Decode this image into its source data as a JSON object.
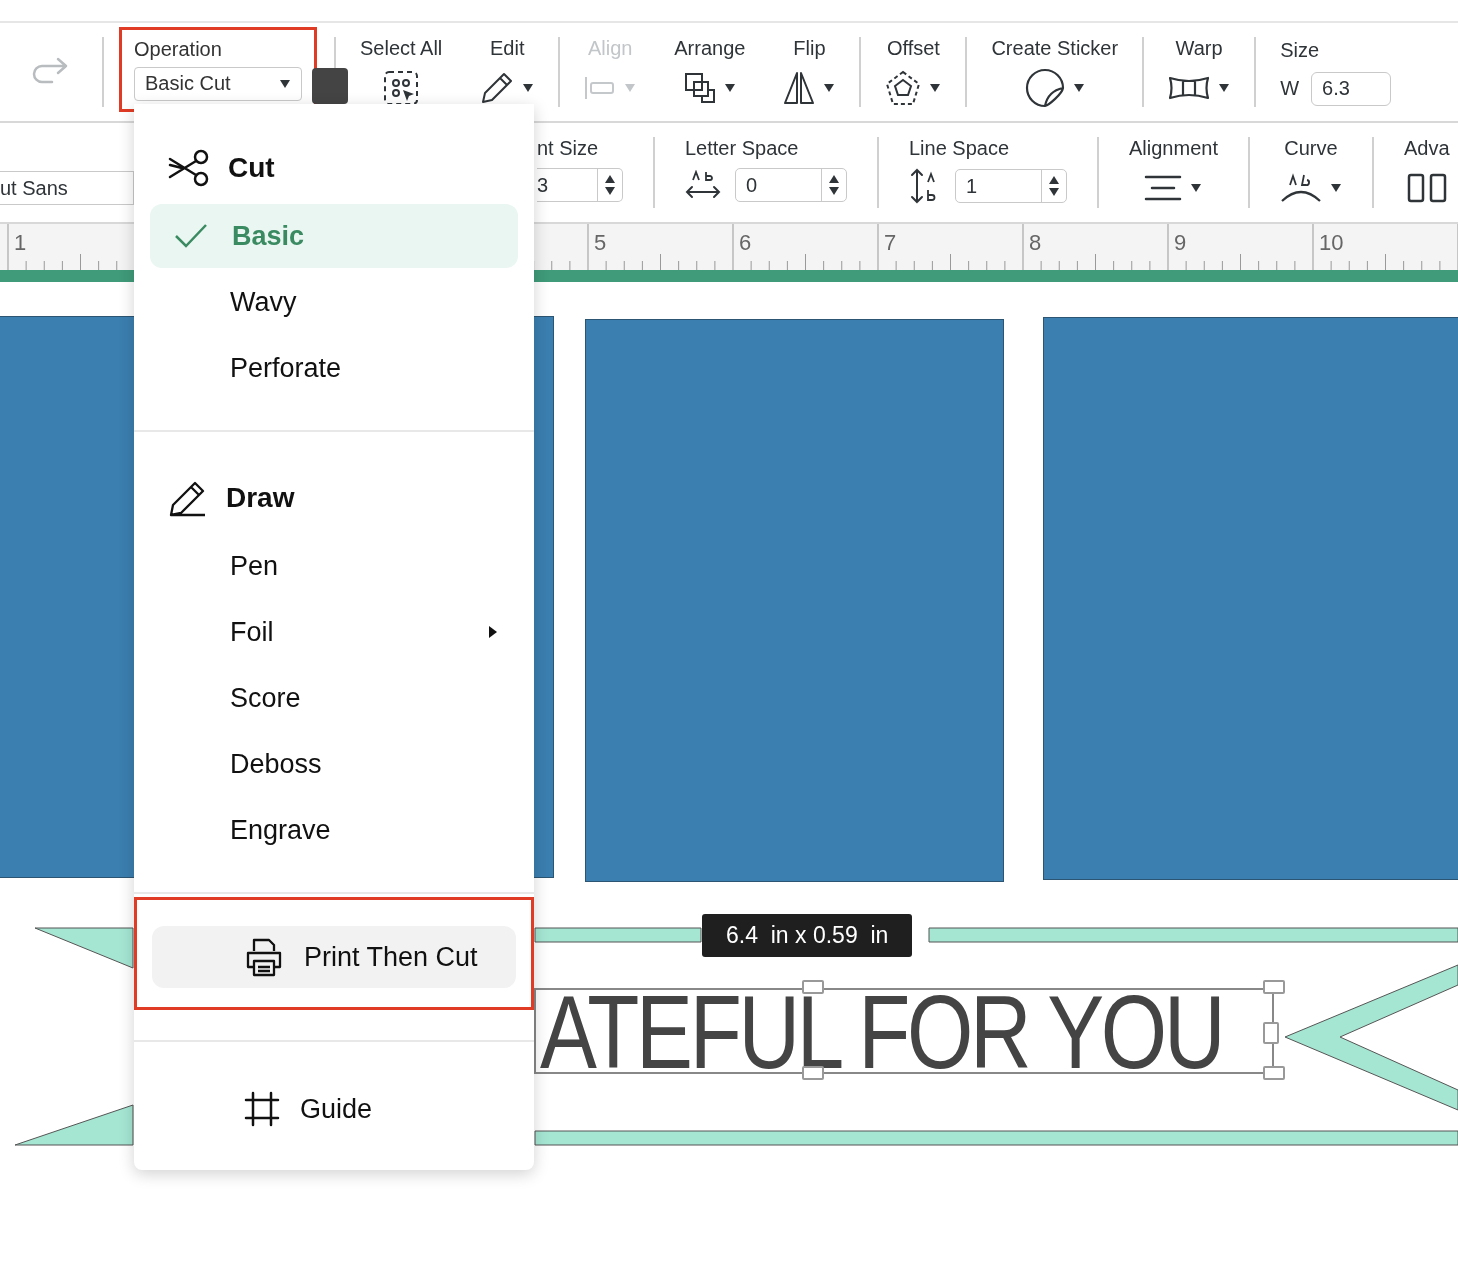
{
  "toolbar": {
    "groups": [
      {
        "tools": [
          {
            "kind": "icon",
            "disabled": true
          }
        ]
      },
      {
        "tools": [
          {
            "kind": "select",
            "label": "Operation",
            "value": "Basic Cut",
            "highlighted": true
          }
        ]
      },
      {
        "tools": [
          {
            "kind": "tool",
            "label": "Select All",
            "dropdown": false,
            "disabled": false
          },
          {
            "kind": "tool",
            "label": "Edit",
            "dropdown": true,
            "disabled": false
          }
        ]
      },
      {
        "tools": [
          {
            "kind": "tool",
            "label": "Align",
            "dropdown": true,
            "disabled": true
          },
          {
            "kind": "tool",
            "label": "Arrange",
            "dropdown": true,
            "disabled": false
          },
          {
            "kind": "tool",
            "label": "Flip",
            "dropdown": true,
            "disabled": false
          }
        ]
      },
      {
        "tools": [
          {
            "kind": "tool",
            "label": "Offset",
            "dropdown": true,
            "disabled": false
          }
        ]
      },
      {
        "tools": [
          {
            "kind": "tool",
            "label": "Create Sticker",
            "dropdown": true,
            "disabled": false
          }
        ]
      },
      {
        "tools": [
          {
            "kind": "tool",
            "label": "Warp",
            "dropdown": true,
            "disabled": false
          }
        ]
      },
      {
        "tools": [
          {
            "kind": "size",
            "label": "Size",
            "axis": "W",
            "value": "6.3"
          }
        ]
      }
    ]
  },
  "text_toolbar": {
    "font": "ut Sans",
    "groups": [
      {
        "kind": "spinner",
        "label": "nt Size",
        "value": "3"
      },
      {
        "kind": "spinner",
        "label": "Letter Space",
        "value": "0"
      },
      {
        "kind": "spinner",
        "label": "Line Space",
        "value": "1"
      },
      {
        "kind": "tool",
        "label": "Alignment",
        "dropdown": true
      },
      {
        "kind": "tool",
        "label": "Curve",
        "dropdown": true
      },
      {
        "kind": "tool",
        "label": "Adva",
        "dropdown": false
      }
    ]
  },
  "ruler": {
    "labels": [
      "1",
      "5",
      "6",
      "7",
      "8",
      "9",
      "10"
    ]
  },
  "canvas": {
    "dimension_tooltip": "6.4  in x 0.59  in",
    "banner_text": "ATEFUL FOR YOU"
  },
  "menu": {
    "sections": [
      {
        "kind": "group",
        "title": "Cut",
        "items": [
          {
            "label": "Basic",
            "selected": true,
            "submenu": false
          },
          {
            "label": "Wavy",
            "selected": false,
            "submenu": false
          },
          {
            "label": "Perforate",
            "selected": false,
            "submenu": false
          }
        ]
      },
      {
        "kind": "group",
        "title": "Draw",
        "items": [
          {
            "label": "Pen",
            "selected": false,
            "submenu": false
          },
          {
            "label": "Foil",
            "selected": false,
            "submenu": true
          },
          {
            "label": "Score",
            "selected": false,
            "submenu": false
          },
          {
            "label": "Deboss",
            "selected": false,
            "submenu": false
          },
          {
            "label": "Engrave",
            "selected": false,
            "submenu": false
          }
        ]
      },
      {
        "kind": "action",
        "label": "Print Then Cut",
        "hovered": true,
        "highlighted": true
      },
      {
        "kind": "action",
        "label": "Guide",
        "hovered": false,
        "highlighted": false
      }
    ]
  }
}
